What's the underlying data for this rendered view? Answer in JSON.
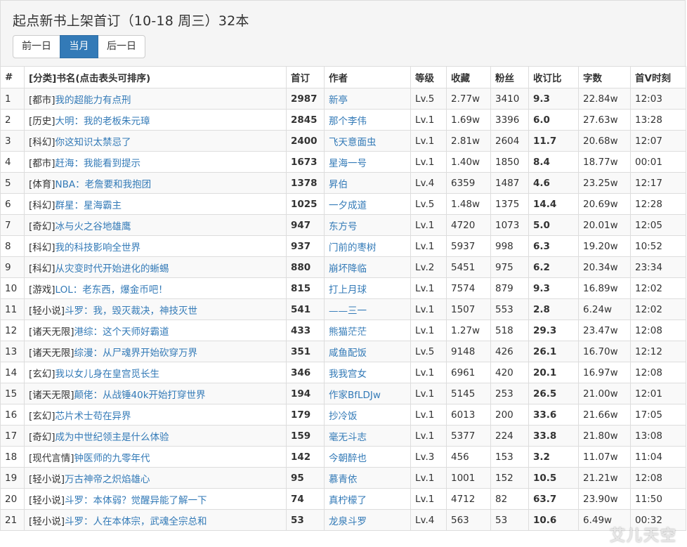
{
  "header": {
    "title": "起点新书上架首订（10-18 周三）32本",
    "nav": {
      "prev": "前一日",
      "current": "当月",
      "next": "后一日"
    }
  },
  "columns": [
    "#",
    "[分类]书名(点击表头可排序)",
    "首订",
    "作者",
    "等级",
    "收藏",
    "粉丝",
    "收订比",
    "字数",
    "首V时刻"
  ],
  "rows": [
    {
      "n": "1",
      "cat": "[都市]",
      "name": "我的超能力有点刑",
      "first": "2987",
      "author": "新亭",
      "level": "Lv.5",
      "fav": "2.77w",
      "fans": "3410",
      "ratio": "9.3",
      "words": "22.84w",
      "time": "12:03"
    },
    {
      "n": "2",
      "cat": "[历史]",
      "name": "大明：我的老板朱元璋",
      "first": "2845",
      "author": "那个李伟",
      "level": "Lv.1",
      "fav": "1.69w",
      "fans": "3396",
      "ratio": "6.0",
      "words": "27.63w",
      "time": "13:28"
    },
    {
      "n": "3",
      "cat": "[科幻]",
      "name": "你这知识太禁忌了",
      "first": "2400",
      "author": "飞天意面虫",
      "level": "Lv.1",
      "fav": "2.81w",
      "fans": "2604",
      "ratio": "11.7",
      "words": "20.68w",
      "time": "12:07"
    },
    {
      "n": "4",
      "cat": "[都市]",
      "name": "赶海：我能看到提示",
      "first": "1673",
      "author": "星海一号",
      "level": "Lv.1",
      "fav": "1.40w",
      "fans": "1850",
      "ratio": "8.4",
      "words": "18.77w",
      "time": "00:01"
    },
    {
      "n": "5",
      "cat": "[体育]",
      "name": "NBA：老詹要和我抱团",
      "first": "1378",
      "author": "昇伯",
      "level": "Lv.4",
      "fav": "6359",
      "fans": "1487",
      "ratio": "4.6",
      "words": "23.25w",
      "time": "12:17"
    },
    {
      "n": "6",
      "cat": "[科幻]",
      "name": "群星：星海霸主",
      "first": "1025",
      "author": "一夕成道",
      "level": "Lv.5",
      "fav": "1.48w",
      "fans": "1375",
      "ratio": "14.4",
      "words": "20.69w",
      "time": "12:28"
    },
    {
      "n": "7",
      "cat": "[奇幻]",
      "name": "冰与火之谷地雄鹰",
      "first": "947",
      "author": "东方号",
      "level": "Lv.1",
      "fav": "4720",
      "fans": "1073",
      "ratio": "5.0",
      "words": "20.01w",
      "time": "12:05"
    },
    {
      "n": "8",
      "cat": "[科幻]",
      "name": "我的科技影响全世界",
      "first": "937",
      "author": "门前的枣树",
      "level": "Lv.1",
      "fav": "5937",
      "fans": "998",
      "ratio": "6.3",
      "words": "19.20w",
      "time": "10:52"
    },
    {
      "n": "9",
      "cat": "[科幻]",
      "name": "从灾变时代开始进化的蜥蜴",
      "first": "880",
      "author": "崩坏降临",
      "level": "Lv.2",
      "fav": "5451",
      "fans": "975",
      "ratio": "6.2",
      "words": "20.34w",
      "time": "23:34"
    },
    {
      "n": "10",
      "cat": "[游戏]",
      "name": "LOL：老东西，爆金币吧！",
      "first": "815",
      "author": "打上月球",
      "level": "Lv.1",
      "fav": "7574",
      "fans": "879",
      "ratio": "9.3",
      "words": "16.89w",
      "time": "12:02"
    },
    {
      "n": "11",
      "cat": "[轻小说]",
      "name": "斗罗：我，毁灭裁决，神技灭世",
      "first": "541",
      "author": "——三一",
      "level": "Lv.1",
      "fav": "1507",
      "fans": "553",
      "ratio": "2.8",
      "words": "6.24w",
      "time": "12:02"
    },
    {
      "n": "12",
      "cat": "[诸天无限]",
      "name": "港综：这个天师好霸道",
      "first": "433",
      "author": "熊猫茫茫",
      "level": "Lv.1",
      "fav": "1.27w",
      "fans": "518",
      "ratio": "29.3",
      "words": "23.47w",
      "time": "12:08"
    },
    {
      "n": "13",
      "cat": "[诸天无限]",
      "name": "综漫：从尸魂界开始砍穿万界",
      "first": "351",
      "author": "咸鱼配饭",
      "level": "Lv.5",
      "fav": "9148",
      "fans": "426",
      "ratio": "26.1",
      "words": "16.70w",
      "time": "12:12"
    },
    {
      "n": "14",
      "cat": "[玄幻]",
      "name": "我以女儿身在皇宫觅长生",
      "first": "346",
      "author": "我我宫女",
      "level": "Lv.1",
      "fav": "6961",
      "fans": "420",
      "ratio": "20.1",
      "words": "16.97w",
      "time": "12:08"
    },
    {
      "n": "15",
      "cat": "[诸天无限]",
      "name": "颠佬：从战锤40k开始打穿世界",
      "first": "194",
      "author": "作家BfLDJw",
      "level": "Lv.1",
      "fav": "5145",
      "fans": "253",
      "ratio": "26.5",
      "words": "21.00w",
      "time": "12:01"
    },
    {
      "n": "16",
      "cat": "[玄幻]",
      "name": "芯片术士苟在异界",
      "first": "179",
      "author": "抄冷饭",
      "level": "Lv.1",
      "fav": "6013",
      "fans": "200",
      "ratio": "33.6",
      "words": "21.66w",
      "time": "17:05"
    },
    {
      "n": "17",
      "cat": "[奇幻]",
      "name": "成为中世纪领主是什么体验",
      "first": "159",
      "author": "毫无斗志",
      "level": "Lv.1",
      "fav": "5377",
      "fans": "224",
      "ratio": "33.8",
      "words": "21.80w",
      "time": "13:08"
    },
    {
      "n": "18",
      "cat": "[现代言情]",
      "name": "钟医师的九零年代",
      "first": "142",
      "author": "今朝醉也",
      "level": "Lv.3",
      "fav": "456",
      "fans": "153",
      "ratio": "3.2",
      "words": "11.07w",
      "time": "11:04"
    },
    {
      "n": "19",
      "cat": "[轻小说]",
      "name": "万古神帝之炽焰雄心",
      "first": "95",
      "author": "慕青依",
      "level": "Lv.1",
      "fav": "1001",
      "fans": "152",
      "ratio": "10.5",
      "words": "21.21w",
      "time": "12:08"
    },
    {
      "n": "20",
      "cat": "[轻小说]",
      "name": "斗罗：本体弱？觉醒异能了解一下",
      "first": "74",
      "author": "真柠檬了",
      "level": "Lv.1",
      "fav": "4712",
      "fans": "82",
      "ratio": "63.7",
      "words": "23.90w",
      "time": "11:50"
    },
    {
      "n": "21",
      "cat": "[轻小说]",
      "name": "斗罗：人在本体宗，武魂全宗总和",
      "first": "53",
      "author": "龙泉斗罗",
      "level": "Lv.4",
      "fav": "563",
      "fans": "53",
      "ratio": "10.6",
      "words": "6.49w",
      "time": "00:32"
    }
  ],
  "watermark": "艾儿天空",
  "colors": {
    "link": "#337ab7",
    "active_button": "#337ab7",
    "stripe": "#f9f9f9",
    "border": "#dddddd"
  }
}
